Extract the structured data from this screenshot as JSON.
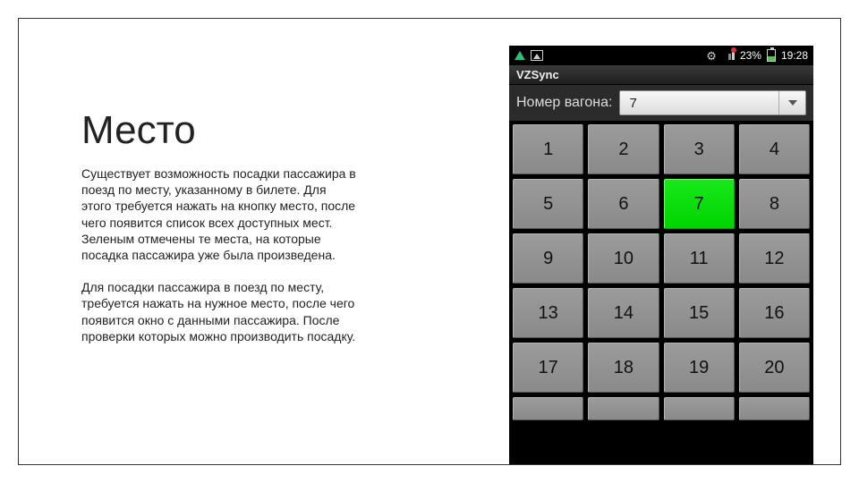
{
  "heading": "Место",
  "paragraph1": "Существует возможность посадки пассажира в поезд по месту, указанному в билете. Для этого требуется нажать на кнопку место, после чего появится список всех доступных мест. Зеленым отмечены те места, на которые посадка пассажира уже была произведена.",
  "paragraph2": "Для посадки пассажира в поезд по месту, требуется нажать на нужное место, после чего появится окно с данными пассажира. После проверки которых можно производить посадку.",
  "status": {
    "battery_text": "23%",
    "time": "19:28"
  },
  "app_title": "VZSync",
  "wagon": {
    "label": "Номер вагона:",
    "value": "7"
  },
  "seats": [
    {
      "n": "1",
      "green": false
    },
    {
      "n": "2",
      "green": false
    },
    {
      "n": "3",
      "green": false
    },
    {
      "n": "4",
      "green": false
    },
    {
      "n": "5",
      "green": false
    },
    {
      "n": "6",
      "green": false
    },
    {
      "n": "7",
      "green": true
    },
    {
      "n": "8",
      "green": false
    },
    {
      "n": "9",
      "green": false
    },
    {
      "n": "10",
      "green": false
    },
    {
      "n": "11",
      "green": false
    },
    {
      "n": "12",
      "green": false
    },
    {
      "n": "13",
      "green": false
    },
    {
      "n": "14",
      "green": false
    },
    {
      "n": "15",
      "green": false
    },
    {
      "n": "16",
      "green": false
    },
    {
      "n": "17",
      "green": false
    },
    {
      "n": "18",
      "green": false
    },
    {
      "n": "19",
      "green": false
    },
    {
      "n": "20",
      "green": false
    }
  ],
  "partial_seats": [
    "",
    "",
    "",
    ""
  ]
}
